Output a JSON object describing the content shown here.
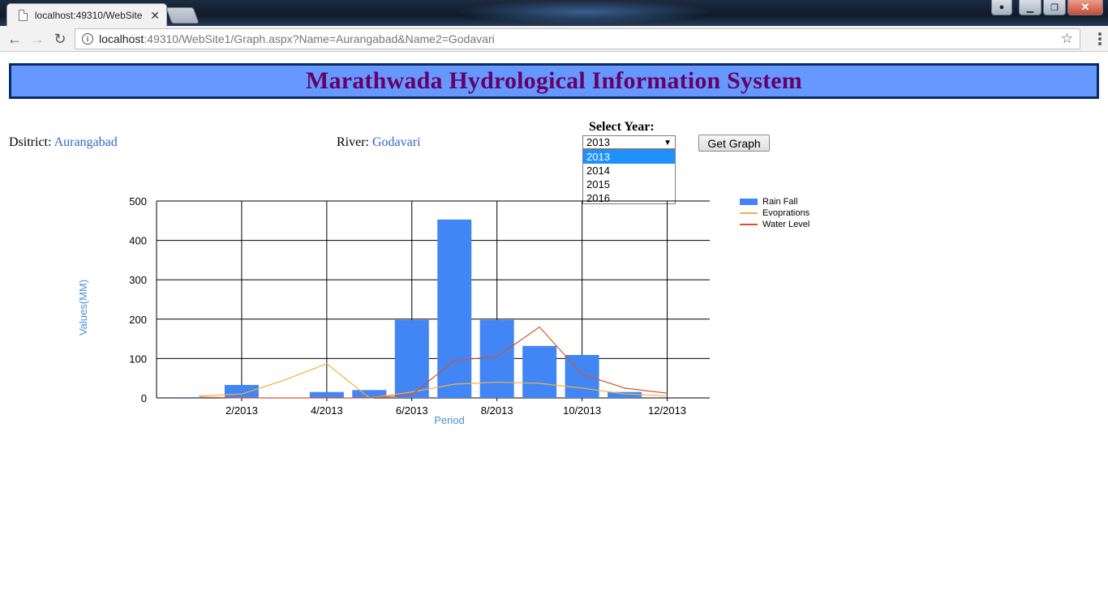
{
  "browser": {
    "tab_title": "localhost:49310/WebSite",
    "url_host": "localhost",
    "url_rest": ":49310/WebSite1/Graph.aspx?Name=Aurangabad&Name2=Godavari"
  },
  "page": {
    "title": "Marathwada Hydrological Information System",
    "district_label": "Dsitrict:",
    "district_value": "Aurangabad",
    "river_label": "River:",
    "river_value": "Godavari",
    "year_label": "Select Year:",
    "year_selected": "2013",
    "year_options": [
      "2013",
      "2014",
      "2015",
      "2016"
    ],
    "button_label": "Get Graph"
  },
  "colors": {
    "banner_bg": "#6699ff",
    "banner_border": "#0a2a66",
    "title_color": "#660066",
    "bar": "#4285f4",
    "evaporation": "#f5b041",
    "water_level": "#d3542a",
    "axis_title": "#4a90d9"
  },
  "chart_data": {
    "type": "bar",
    "xlabel": "Period",
    "ylabel": "Values(MM)",
    "ylim": [
      0,
      500
    ],
    "yticks": [
      0,
      100,
      200,
      300,
      400,
      500
    ],
    "xticks": [
      "2/2013",
      "4/2013",
      "6/2013",
      "8/2013",
      "10/2013",
      "12/2013"
    ],
    "x": [
      1,
      2,
      3,
      4,
      5,
      6,
      7,
      8,
      9,
      10,
      11,
      12
    ],
    "grid": true,
    "legend": "right",
    "series": [
      {
        "name": "Rain Fall",
        "type": "bar",
        "values": [
          2,
          33,
          0,
          15,
          20,
          198,
          453,
          198,
          132,
          109,
          15,
          0
        ]
      },
      {
        "name": "Evoprations",
        "type": "line",
        "values": [
          5,
          10,
          45,
          87,
          0,
          15,
          35,
          40,
          37,
          25,
          10,
          5
        ]
      },
      {
        "name": "Water Level",
        "type": "line",
        "values": [
          2,
          0,
          0,
          0,
          0,
          8,
          95,
          105,
          180,
          60,
          25,
          12
        ]
      }
    ]
  }
}
